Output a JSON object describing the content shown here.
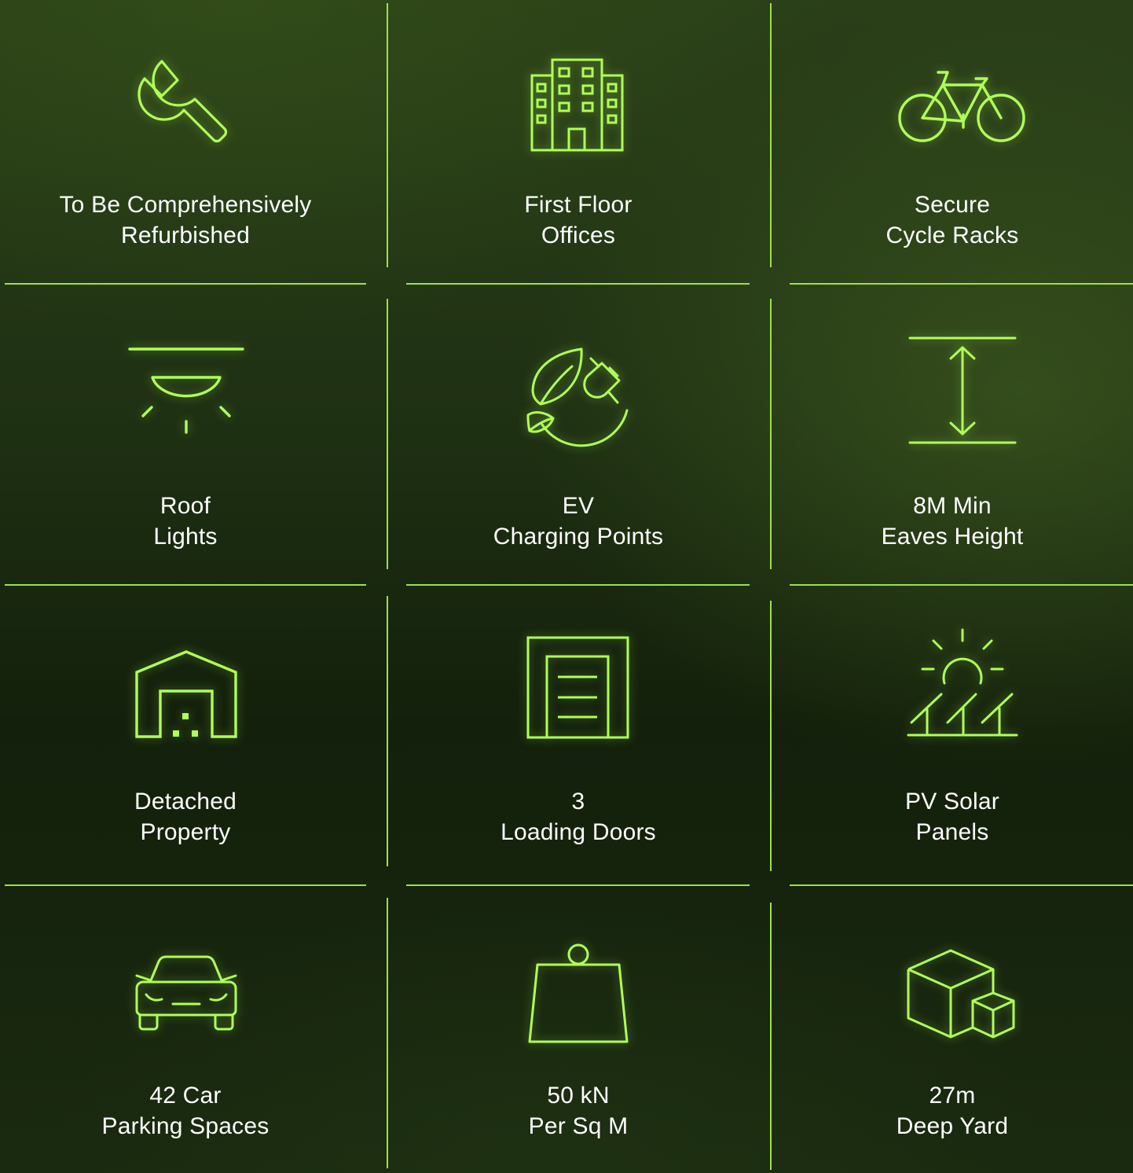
{
  "accent_color": "#b0ff57",
  "features": [
    {
      "icon": "wrench-icon",
      "line1": "To Be Comprehensively",
      "line2": "Refurbished"
    },
    {
      "icon": "office-building-icon",
      "line1": "First Floor",
      "line2": "Offices"
    },
    {
      "icon": "bicycle-icon",
      "line1": "Secure",
      "line2": "Cycle Racks"
    },
    {
      "icon": "ceiling-light-icon",
      "line1": "Roof",
      "line2": "Lights"
    },
    {
      "icon": "eco-plug-globe-icon",
      "line1": "EV",
      "line2": "Charging Points"
    },
    {
      "icon": "height-arrow-icon",
      "line1": "8M Min",
      "line2": "Eaves Height"
    },
    {
      "icon": "warehouse-icon",
      "line1": "Detached",
      "line2": "Property"
    },
    {
      "icon": "loading-door-icon",
      "line1": "3",
      "line2": "Loading Doors"
    },
    {
      "icon": "solar-panel-icon",
      "line1": "PV Solar",
      "line2": "Panels"
    },
    {
      "icon": "car-front-icon",
      "line1": "42 Car",
      "line2": "Parking Spaces"
    },
    {
      "icon": "weight-icon",
      "line1": "50 kN",
      "line2": "Per Sq M"
    },
    {
      "icon": "boxes-icon",
      "line1": "27m",
      "line2": "Deep Yard"
    }
  ]
}
